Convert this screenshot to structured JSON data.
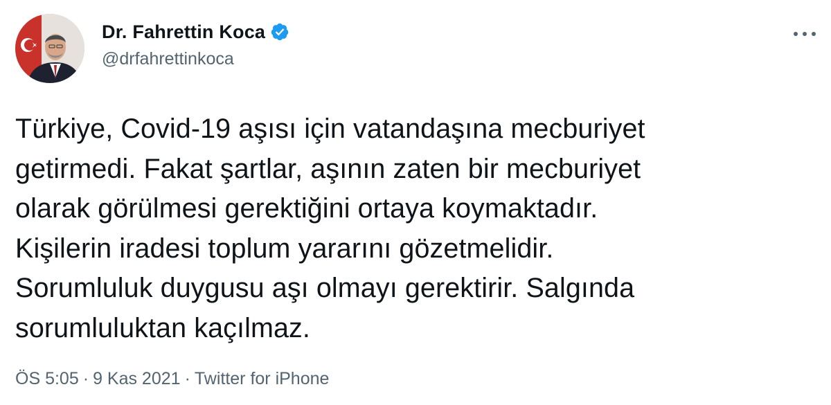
{
  "author": {
    "display_name": "Dr. Fahrettin Koca",
    "handle": "@drfahrettinkoca",
    "verified": true
  },
  "tweet": {
    "lines": [
      "Türkiye, Covid-19 aşısı için vatandaşına mecburiyet",
      "getirmedi. Fakat şartlar, aşının zaten bir mecburiyet",
      "olarak görülmesi gerektiğini ortaya koymaktadır.",
      "Kişilerin iradesi toplum yararını gözetmelidir.",
      "Sorumluluk duygusu aşı olmayı gerektirir. Salgında",
      "sorumluluktan kaçılmaz."
    ]
  },
  "meta": {
    "time": "ÖS 5:05",
    "separator": "·",
    "date": "9 Kas 2021",
    "source": "Twitter for iPhone"
  },
  "icons": {
    "verified": "verified-badge-icon",
    "more": "more-options-icon"
  },
  "colors": {
    "text": "#0f1419",
    "secondary_text": "#536471",
    "verified_blue": "#1d9bf0"
  }
}
